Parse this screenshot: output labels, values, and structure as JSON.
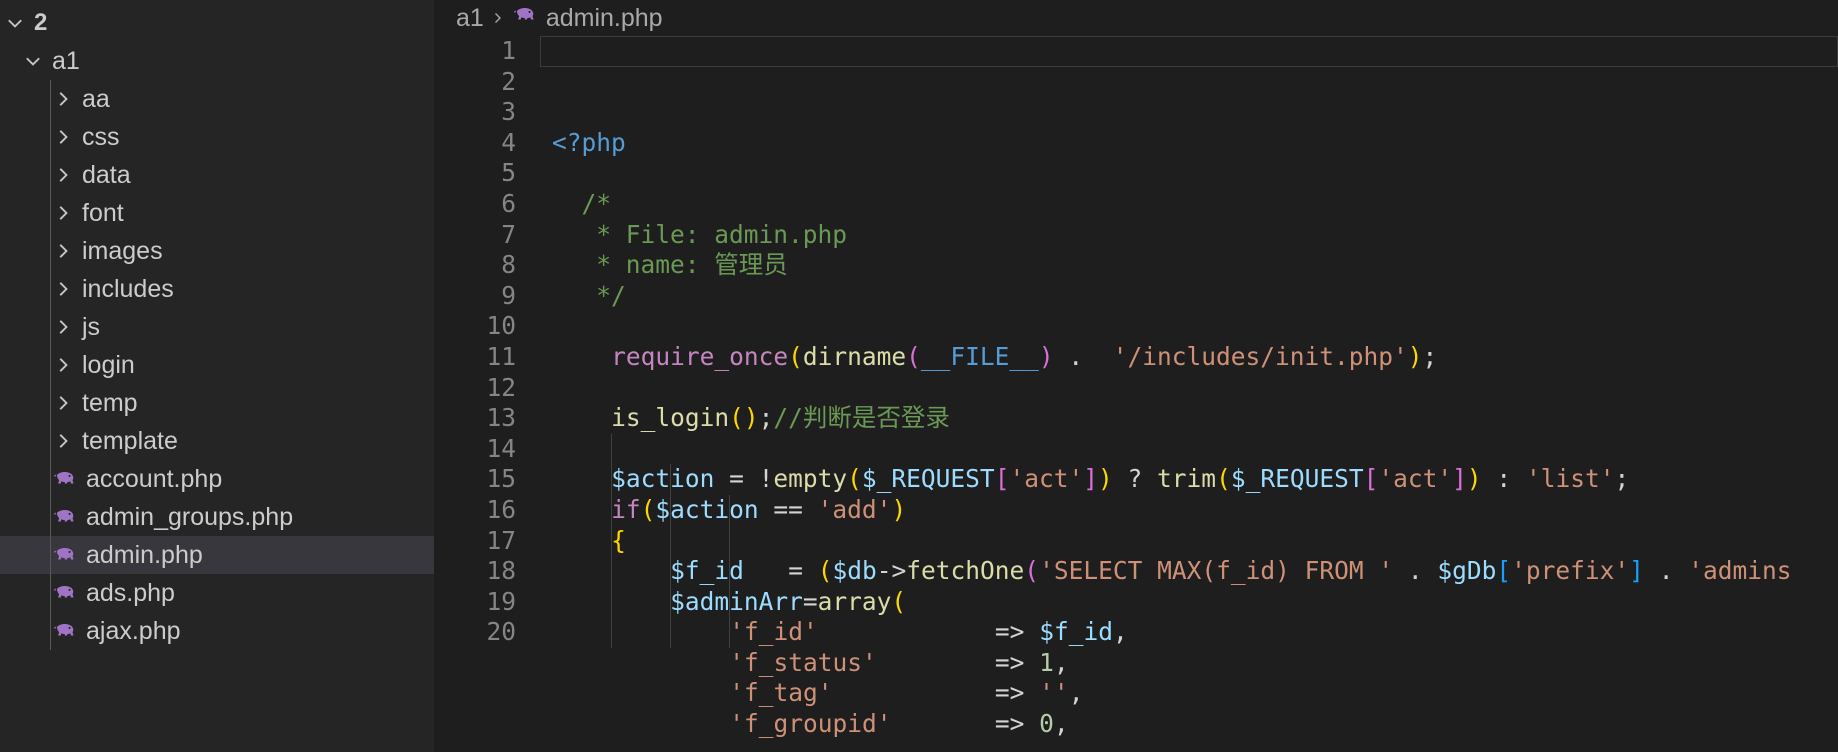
{
  "window": {
    "title": "admin.php"
  },
  "sidebar": {
    "root": {
      "label": "2",
      "expanded": true,
      "icon": "chevron-down-icon"
    },
    "items": [
      {
        "label": "a1",
        "type": "folder",
        "depth": 1,
        "expanded": true,
        "icon": "chevron-down-icon"
      },
      {
        "label": "aa",
        "type": "folder",
        "depth": 2,
        "expanded": false,
        "icon": "chevron-right-icon"
      },
      {
        "label": "css",
        "type": "folder",
        "depth": 2,
        "expanded": false,
        "icon": "chevron-right-icon"
      },
      {
        "label": "data",
        "type": "folder",
        "depth": 2,
        "expanded": false,
        "icon": "chevron-right-icon"
      },
      {
        "label": "font",
        "type": "folder",
        "depth": 2,
        "expanded": false,
        "icon": "chevron-right-icon"
      },
      {
        "label": "images",
        "type": "folder",
        "depth": 2,
        "expanded": false,
        "icon": "chevron-right-icon"
      },
      {
        "label": "includes",
        "type": "folder",
        "depth": 2,
        "expanded": false,
        "icon": "chevron-right-icon"
      },
      {
        "label": "js",
        "type": "folder",
        "depth": 2,
        "expanded": false,
        "icon": "chevron-right-icon"
      },
      {
        "label": "login",
        "type": "folder",
        "depth": 2,
        "expanded": false,
        "icon": "chevron-right-icon"
      },
      {
        "label": "temp",
        "type": "folder",
        "depth": 2,
        "expanded": false,
        "icon": "chevron-right-icon"
      },
      {
        "label": "template",
        "type": "folder",
        "depth": 2,
        "expanded": false,
        "icon": "chevron-right-icon"
      },
      {
        "label": "account.php",
        "type": "file",
        "depth": 2,
        "icon": "php-elephant-icon"
      },
      {
        "label": "admin_groups.php",
        "type": "file",
        "depth": 2,
        "icon": "php-elephant-icon"
      },
      {
        "label": "admin.php",
        "type": "file",
        "depth": 2,
        "icon": "php-elephant-icon",
        "selected": true
      },
      {
        "label": "ads.php",
        "type": "file",
        "depth": 2,
        "icon": "php-elephant-icon"
      },
      {
        "label": "ajax.php",
        "type": "file",
        "depth": 2,
        "icon": "php-elephant-icon"
      }
    ]
  },
  "breadcrumb": {
    "folder": "a1",
    "separator": "›",
    "file": "admin.php",
    "file_icon": "php-elephant-icon"
  },
  "editor": {
    "language": "php",
    "first_line": 1,
    "line_numbers": [
      1,
      2,
      3,
      4,
      5,
      6,
      7,
      8,
      9,
      10,
      11,
      12,
      13,
      14,
      15,
      16,
      17,
      18,
      19,
      20
    ],
    "lines": [
      {
        "n": 1,
        "text": "<?php"
      },
      {
        "n": 2,
        "text": ""
      },
      {
        "n": 3,
        "text": "  /*"
      },
      {
        "n": 4,
        "text": "   * File: admin.php"
      },
      {
        "n": 5,
        "text": "   * name: 管理员"
      },
      {
        "n": 6,
        "text": "   */"
      },
      {
        "n": 7,
        "text": ""
      },
      {
        "n": 8,
        "text": "    require_once(dirname(__FILE__) .  '/includes/init.php');"
      },
      {
        "n": 9,
        "text": ""
      },
      {
        "n": 10,
        "text": "    is_login();//判断是否登录"
      },
      {
        "n": 11,
        "text": ""
      },
      {
        "n": 12,
        "text": "    $action = !empty($_REQUEST['act']) ? trim($_REQUEST['act']) : 'list';"
      },
      {
        "n": 13,
        "text": "    if($action == 'add')"
      },
      {
        "n": 14,
        "text": "    {"
      },
      {
        "n": 15,
        "text": "        $f_id   = ($db->fetchOne('SELECT MAX(f_id) FROM ' . $gDb['prefix'] . 'admins"
      },
      {
        "n": 16,
        "text": "        $adminArr=array("
      },
      {
        "n": 17,
        "text": "            'f_id'            => $f_id,"
      },
      {
        "n": 18,
        "text": "            'f_status'        => 1,"
      },
      {
        "n": 19,
        "text": "            'f_tag'           => '',"
      },
      {
        "n": 20,
        "text": "            'f_groupid'       => 0,"
      }
    ]
  },
  "colors": {
    "editor_background": "#1e1e1e",
    "sidebar_background": "#252526",
    "selection_background": "#37373d",
    "line_number": "#858585",
    "foreground": "#d4d4d4",
    "comment": "#6a9955",
    "string": "#ce9178",
    "number": "#b5cea8",
    "keyword_control": "#c586c0",
    "keyword_blue": "#569cd6",
    "function": "#dcdcaa",
    "variable": "#9cdcfe",
    "bracket_1": "#ffd700",
    "bracket_2": "#da70d6",
    "bracket_3": "#179fff",
    "php_icon": "#a074c4"
  }
}
